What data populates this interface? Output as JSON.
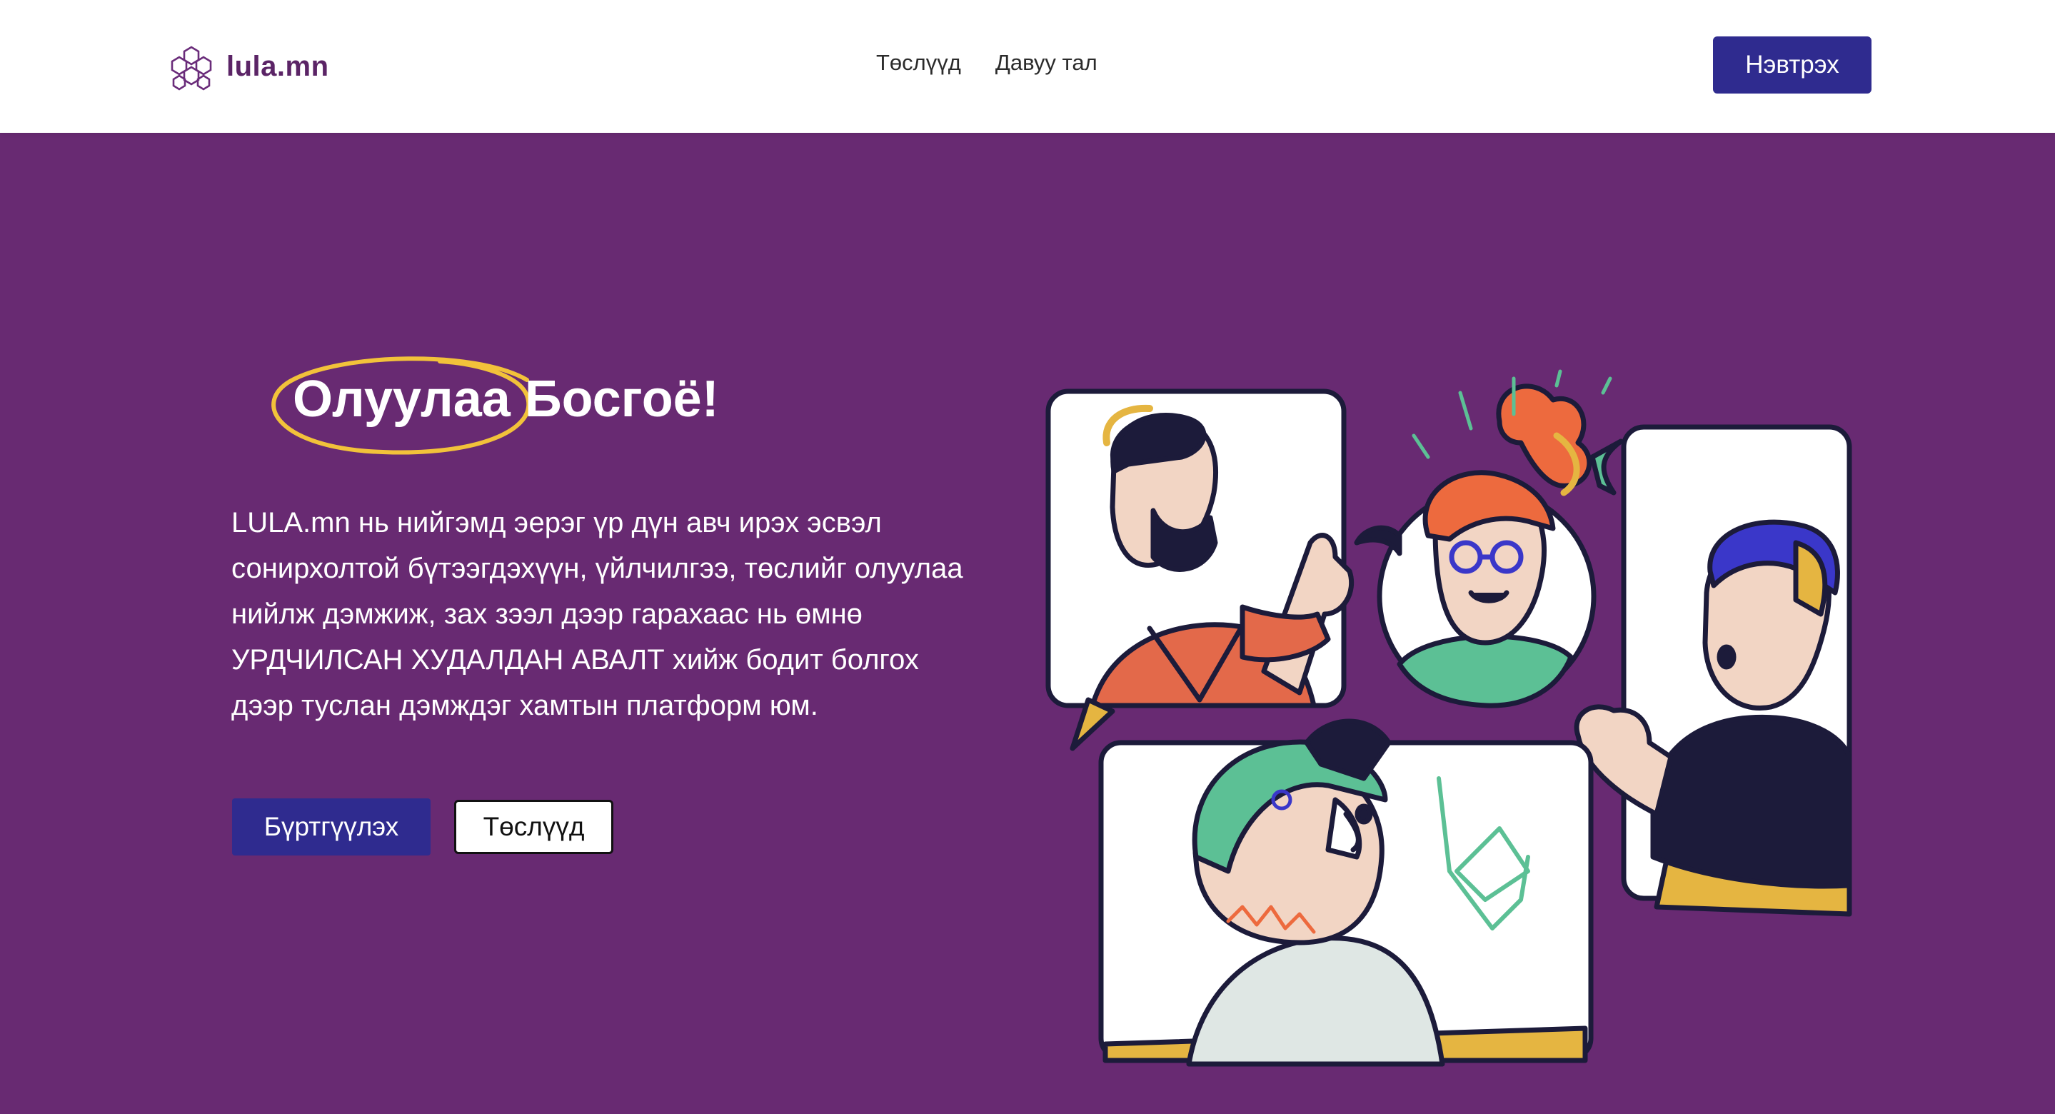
{
  "header": {
    "brand": "lula.mn",
    "nav": [
      "Төслүүд",
      "Давуу тал"
    ],
    "login_label": "Нэвтрэх"
  },
  "hero": {
    "title_highlight": "Олуулаа",
    "title_rest": "Босгоё!",
    "description": "LULA.mn нь нийгэмд эерэг үр дүн авч ирэх эсвэл сонирхолтой бүтээгдэхүүн, үйлчилгээ, төслийг олуулаа нийлж дэмжиж, зах зээл дээр гарахаас нь өмнө УРДЧИЛСАН ХУДАЛДАН АВАЛТ хийж бодит болгох дээр туслан дэмждэг хамтын платформ юм.",
    "register_label": "Бүртгүүлэх",
    "projects_label": "Төслүүд"
  },
  "colors": {
    "background": "#682a72",
    "primary": "#2f2b8f",
    "highlight": "#f2c23a",
    "brand_text": "#5b2466"
  },
  "icons": [
    "hexagon-logo-icon",
    "people-illustration"
  ]
}
